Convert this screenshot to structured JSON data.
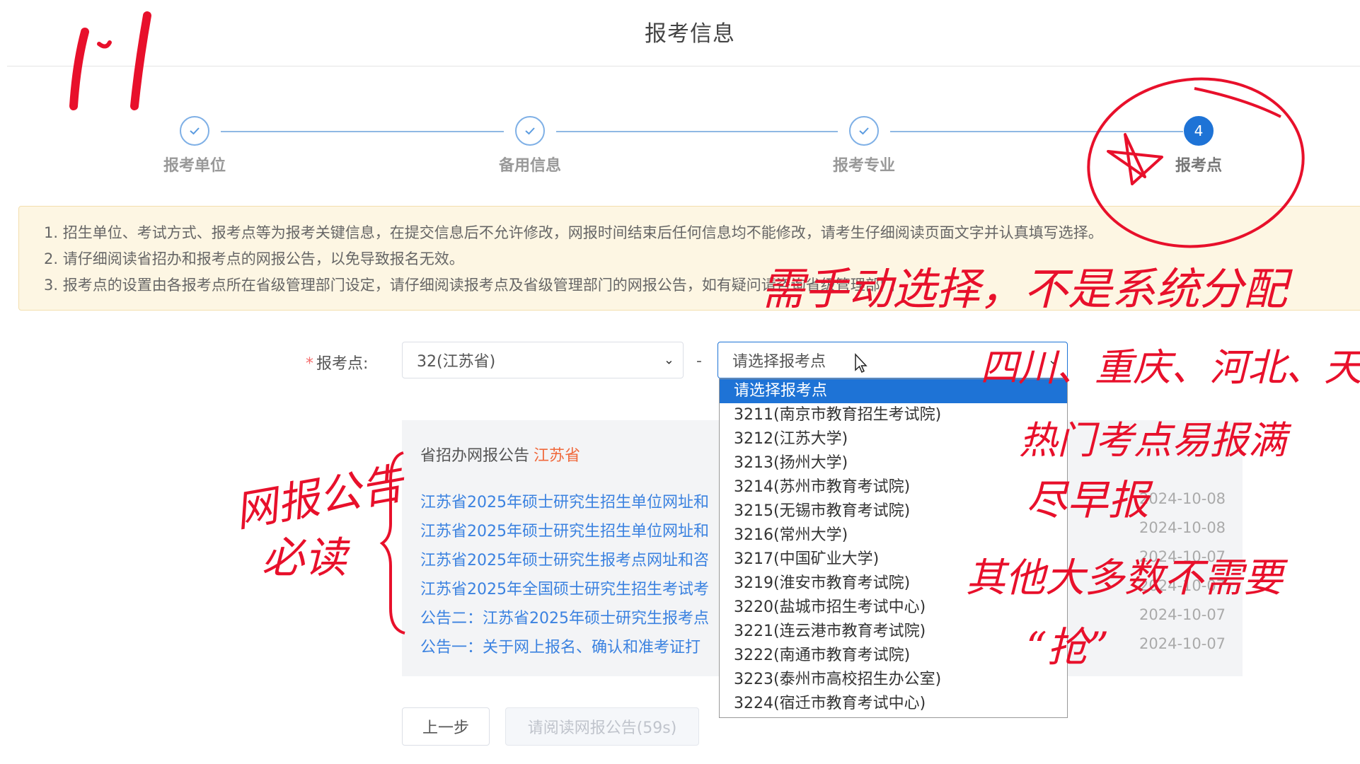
{
  "page": {
    "title": "报考信息"
  },
  "steps": [
    {
      "label": "报考单位",
      "state": "done"
    },
    {
      "label": "备用信息",
      "state": "done"
    },
    {
      "label": "报考专业",
      "state": "done"
    },
    {
      "label": "报考点",
      "state": "active",
      "number": "4"
    }
  ],
  "notice": {
    "lines": [
      "1. 招生单位、考试方式、报考点等为报考关键信息，在提交信息后不允许修改，网报时间结束后任何信息均不能修改，请考生仔细阅读页面文字并认真填写选择。",
      "2. 请仔细阅读省招办和报考点的网报公告，以免导致报名无效。",
      "3. 报考点的设置由各报考点所在省级管理部门设定，请仔细阅读报考点及省级管理部门的网报公告，如有疑问请咨询省级管理部门"
    ]
  },
  "form": {
    "required_mark": "*",
    "label": "报考点:",
    "province_value": "32(江苏省)",
    "separator": "-",
    "site_placeholder": "请选择报考点"
  },
  "dropdown": {
    "options": [
      "请选择报考点",
      "3211(南京市教育招生考试院)",
      "3212(江苏大学)",
      "3213(扬州大学)",
      "3214(苏州市教育考试院)",
      "3215(无锡市教育考试院)",
      "3216(常州大学)",
      "3217(中国矿业大学)",
      "3219(淮安市教育考试院)",
      "3220(盐城市招生考试中心)",
      "3221(连云港市教育考试院)",
      "3222(南通市教育考试院)",
      "3223(泰州市高校招生办公室)",
      "3224(宿迁市教育考试中心)"
    ],
    "selected_index": 0
  },
  "announcements": {
    "title": "省招办网报公告",
    "province": "江苏省",
    "items": [
      {
        "text": "江苏省2025年硕士研究生招生单位网址和",
        "date": "2024-10-08"
      },
      {
        "text": "江苏省2025年硕士研究生招生单位网址和",
        "date": "2024-10-08"
      },
      {
        "text": "江苏省2025年硕士研究生报考点网址和咨",
        "date": "2024-10-07"
      },
      {
        "text": "江苏省2025年全国硕士研究生招生考试考",
        "date": "2024-10-07"
      },
      {
        "text": "公告二：江苏省2025年硕士研究生报考点",
        "date": "2024-10-07"
      },
      {
        "text": "公告一：关于网上报名、确认和准考证打",
        "date": "2024-10-07"
      }
    ]
  },
  "buttons": {
    "prev": "上一步",
    "next": "请阅读网报公告(59s)"
  },
  "handwriting": {
    "number": "11",
    "manual_select": "需手动选择，不是系统分配",
    "regions": "四川、重庆、河北、天津",
    "hot_sites": "热门考点易报满",
    "early": "尽早报",
    "others": "其他大多数不需要",
    "grab": "“抢”",
    "must_read_1": "网报公告",
    "must_read_2": "必读"
  },
  "colors": {
    "primary": "#1e73d6",
    "annotation": "#e8102b",
    "notice_bg": "#fdf6e3"
  }
}
